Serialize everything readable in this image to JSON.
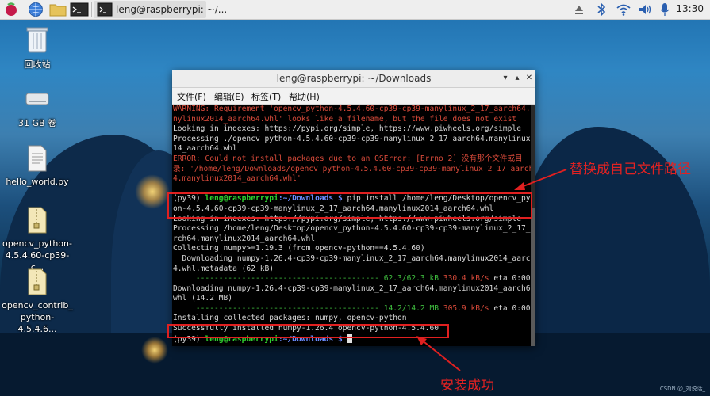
{
  "taskbar": {
    "task_title": "leng@raspberrypi: ~/...",
    "clock": "13:30"
  },
  "desktop": {
    "icons": [
      {
        "label": "回收站"
      },
      {
        "label": "31 GB 卷"
      },
      {
        "label": "hello_world.py"
      },
      {
        "label": "opencv_python-\n4.5.4.60-cp39-c..."
      },
      {
        "label": "opencv_contrib_\npython-4.5.4.6..."
      }
    ]
  },
  "terminal": {
    "title": "leng@raspberrypi: ~/Downloads",
    "menu": [
      "文件(F)",
      "编辑(E)",
      "标签(T)",
      "帮助(H)"
    ],
    "lines": [
      {
        "t": "WARNING: Requirement 'opencv_python-4.5.4.60-cp39-cp39-manylinux_2_17_aarch64.ma",
        "c": "red"
      },
      {
        "t": "nylinux2014_aarch64.whl' looks like a filename, but the file does not exist",
        "c": "red"
      },
      {
        "t": "Looking in indexes: https://pypi.org/simple, https://www.piwheels.org/simple",
        "c": "dim"
      },
      {
        "t": "Processing ./opencv_python-4.5.4.60-cp39-cp39-manylinux_2_17_aarch64.manylinux20",
        "c": "dim"
      },
      {
        "t": "14_aarch64.whl",
        "c": "dim"
      },
      {
        "t": "ERROR: Could not install packages due to an OSError: [Errno 2] 没有那个文件或目",
        "c": "red"
      },
      {
        "t": "录: '/home/leng/Downloads/opencv_python-4.5.4.60-cp39-cp39-manylinux_2_17_aarch6",
        "c": "red"
      },
      {
        "t": "4.manylinux2014_aarch64.whl'",
        "c": "red"
      },
      {
        "t": "",
        "c": "dim"
      }
    ],
    "prompt_env": "(py39) ",
    "prompt_user": "leng@raspberrypi",
    "prompt_path": ":~/Downloads $",
    "command_1": " pip install /home/leng/Desktop/opencv_pyth",
    "command_2": "on-4.5.4.60-cp39-cp39-manylinux_2_17_aarch64.manylinux2014_aarch64.whl",
    "lines2": [
      "Looking in indexes: https://pypi.org/simple, https://www.piwheels.org/simple",
      "Processing /home/leng/Desktop/opencv_python-4.5.4.60-cp39-cp39-manylinux_2_17_aa",
      "rch64.manylinux2014_aarch64.whl",
      "Collecting numpy>=1.19.3 (from opencv-python==4.5.4.60)",
      "  Downloading numpy-1.26.4-cp39-cp39-manylinux_2_17_aarch64.manylinux2014_aarch6",
      "4.whl.metadata (62 kB)"
    ],
    "progress1": {
      "bar": "     ---------------------------------------- ",
      "size": "62.3/62.3 kB",
      "speed": " 330.4 kB/s",
      "eta": " eta 0:00:00"
    },
    "lines3": [
      "Downloading numpy-1.26.4-cp39-cp39-manylinux_2_17_aarch64.manylinux2014_aarch64.",
      "whl (14.2 MB)"
    ],
    "progress2": {
      "bar": "     ---------------------------------------- ",
      "size": "14.2/14.2 MB",
      "speed": " 305.9 kB/s",
      "eta": " eta 0:00:00"
    },
    "installing": "Installing collected packages: numpy, opencv-python",
    "success": "Successfully installed numpy-1.26.4 opencv-python-4.5.4.60"
  },
  "annotations": {
    "replace_path": "替换成自己文件路径",
    "install_success": "安装成功"
  },
  "watermark": "CSDN @_刘说话_",
  "colors": {
    "annotation": "#e02020",
    "prompt_user": "#2fd12f",
    "prompt_path": "#6b8cff"
  }
}
